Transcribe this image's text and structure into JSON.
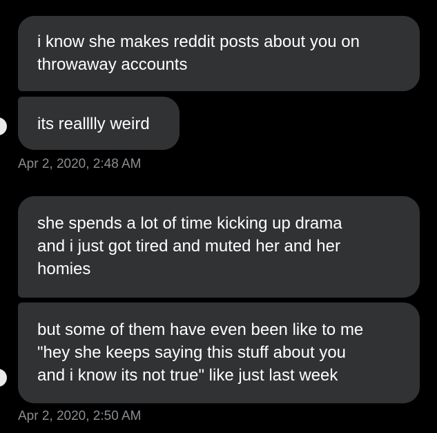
{
  "conversation": {
    "messages": [
      {
        "text": "i know she makes reddit posts about you on\nthroway accounts"
      },
      {
        "text": "its realllly weird"
      },
      {
        "text": "she spends a lot of time kicking up drama\nand i just got tired and muted her and her\nhomies"
      },
      {
        "text": "but some of them have even been like to me\n\"hey she keeps saying this stuff about you\nand i know its not true\" like just last week"
      }
    ],
    "timestamps": [
      "Apr 2, 2020, 2:48 AM",
      "Apr 2, 2020, 2:50 AM"
    ]
  },
  "colors": {
    "background": "#000000",
    "bubble": "#303234",
    "text": "#ffffff",
    "timestamp": "#8a8d91"
  }
}
